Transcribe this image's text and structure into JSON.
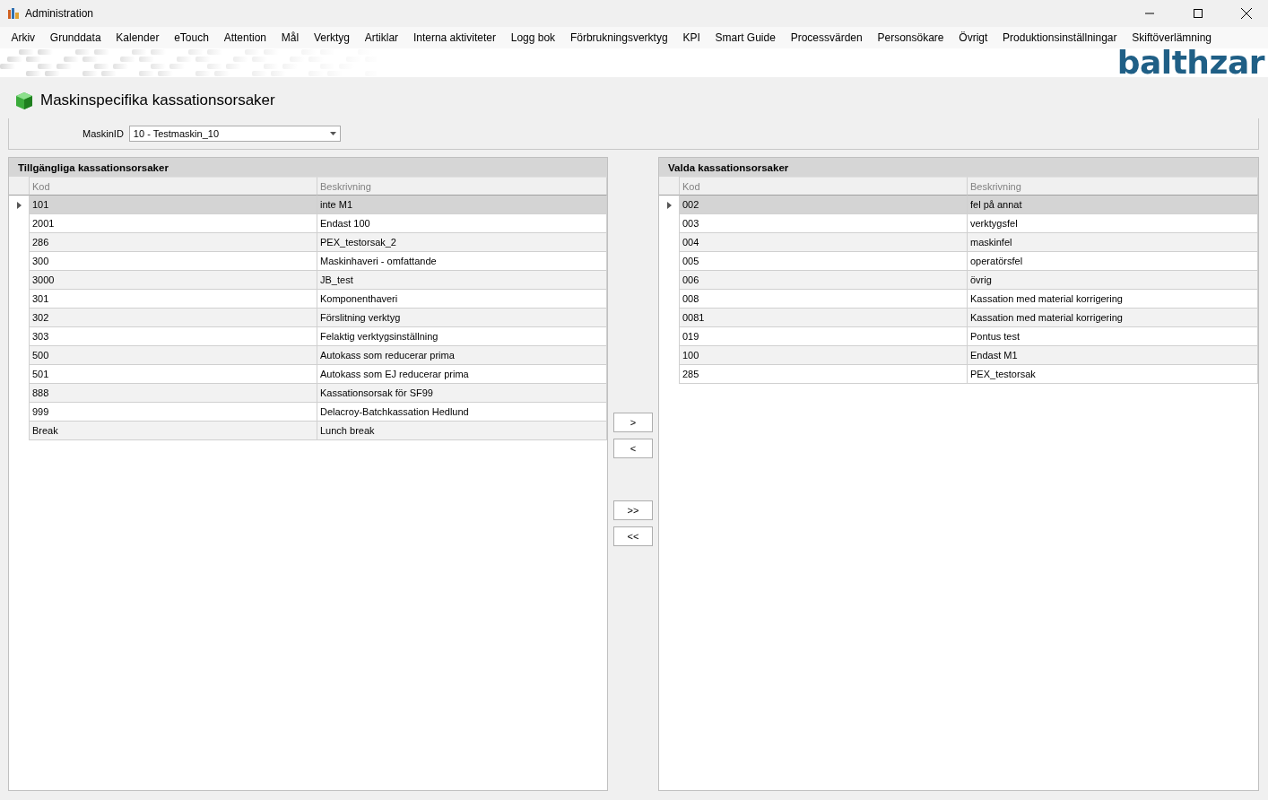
{
  "window": {
    "title": "Administration"
  },
  "menu": [
    "Arkiv",
    "Grunddata",
    "Kalender",
    "eTouch",
    "Attention",
    "Mål",
    "Verktyg",
    "Artiklar",
    "Interna aktiviteter",
    "Logg bok",
    "Förbrukningsverktyg",
    "KPI",
    "Smart Guide",
    "Processvärden",
    "Personsökare",
    "Övrigt",
    "Produktionsinställningar",
    "Skiftöverlämning"
  ],
  "logo": "balthzar",
  "page_title": "Maskinspecifika kassationsorsaker",
  "filter": {
    "label": "MaskinID",
    "value": "10 - Testmaskin_10"
  },
  "available": {
    "title": "Tillgängliga kassationsorsaker",
    "columns": [
      "Kod",
      "Beskrivning"
    ],
    "rows": [
      {
        "cells": [
          "101",
          "inte M1"
        ],
        "selected": true
      },
      {
        "cells": [
          "2001",
          "Endast 100"
        ],
        "selected": false
      },
      {
        "cells": [
          "286",
          "PEX_testorsak_2"
        ],
        "selected": false
      },
      {
        "cells": [
          "300",
          "Maskinhaveri - omfattande"
        ],
        "selected": false
      },
      {
        "cells": [
          "3000",
          "JB_test"
        ],
        "selected": false
      },
      {
        "cells": [
          "301",
          "Komponenthaveri"
        ],
        "selected": false
      },
      {
        "cells": [
          "302",
          "Förslitning verktyg"
        ],
        "selected": false
      },
      {
        "cells": [
          "303",
          "Felaktig verktygsinställning"
        ],
        "selected": false
      },
      {
        "cells": [
          "500",
          "Autokass som reducerar prima"
        ],
        "selected": false
      },
      {
        "cells": [
          "501",
          "Autokass som EJ reducerar prima"
        ],
        "selected": false
      },
      {
        "cells": [
          "888",
          "Kassationsorsak för SF99"
        ],
        "selected": false
      },
      {
        "cells": [
          "999",
          "Delacroy-Batchkassation Hedlund"
        ],
        "selected": false
      },
      {
        "cells": [
          "Break",
          "Lunch break"
        ],
        "selected": false
      }
    ]
  },
  "chosen": {
    "title": "Valda kassationsorsaker",
    "columns": [
      "Kod",
      "Beskrivning"
    ],
    "rows": [
      {
        "cells": [
          "002",
          "fel på annat"
        ],
        "selected": true
      },
      {
        "cells": [
          "003",
          "verktygsfel"
        ],
        "selected": false
      },
      {
        "cells": [
          "004",
          "maskinfel"
        ],
        "selected": false
      },
      {
        "cells": [
          "005",
          "operatörsfel"
        ],
        "selected": false
      },
      {
        "cells": [
          "006",
          "övrig"
        ],
        "selected": false
      },
      {
        "cells": [
          "008",
          "Kassation med material korrigering"
        ],
        "selected": false
      },
      {
        "cells": [
          "0081",
          "Kassation med material korrigering"
        ],
        "selected": false
      },
      {
        "cells": [
          "019",
          "Pontus test"
        ],
        "selected": false
      },
      {
        "cells": [
          "100",
          "Endast M1"
        ],
        "selected": false
      },
      {
        "cells": [
          "285",
          "PEX_testorsak"
        ],
        "selected": false
      }
    ]
  },
  "move_buttons": [
    ">",
    "<",
    ">>",
    "<<"
  ]
}
